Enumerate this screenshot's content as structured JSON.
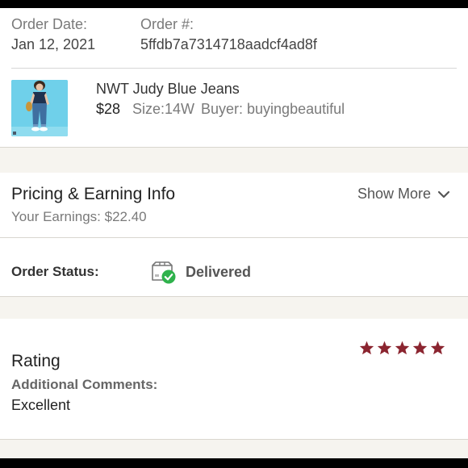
{
  "order": {
    "date_label": "Order Date:",
    "date_value": "Jan 12, 2021",
    "number_label": "Order #:",
    "number_value": "5ffdb7a7314718aadcf4ad8f"
  },
  "item": {
    "title": "NWT Judy Blue Jeans",
    "price": "$28",
    "size": "Size:14W",
    "buyer": "Buyer: buyingbeautiful"
  },
  "pricing": {
    "title": "Pricing & Earning Info",
    "earnings_label": "Your Earnings:",
    "earnings_value": "$22.40",
    "show_more": "Show More"
  },
  "status": {
    "label": "Order Status:",
    "value": "Delivered",
    "icon": "box-delivered-icon"
  },
  "rating": {
    "title": "Rating",
    "stars": 5,
    "max_stars": 5,
    "star_color": "#8b2530",
    "comments_label": "Additional Comments:",
    "comments_value": "Excellent"
  },
  "colors": {
    "check_green": "#2fb24c",
    "thumb_bg": "#6fd0ea"
  }
}
